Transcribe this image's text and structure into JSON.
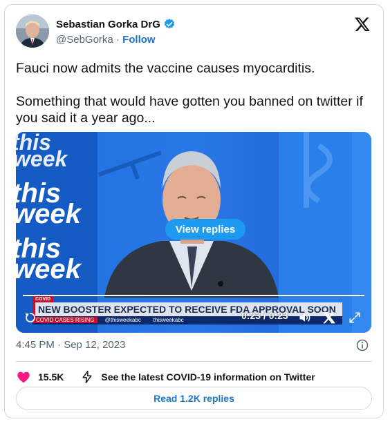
{
  "author": {
    "name": "Sebastian Gorka DrG",
    "handle": "@SebGorka",
    "separator": "·",
    "follow_label": "Follow"
  },
  "tweet": {
    "text": "Fauci now admits the vaccine causes myocarditis.\n\nSomething that would have gotten you banned on twitter if you said it a year ago..."
  },
  "video": {
    "view_replies_label": "View replies",
    "lower_third_tag": "COVID",
    "lower_third_headline": "NEW BOOSTER EXPECTED TO RECEIVE FDA APPROVAL SOON",
    "ticker_label": "COVID CASES RISING",
    "ticker_handle_1": "@thisweekabc",
    "ticker_handle_2": "thisweekabc",
    "time_readout": "0:23 / 0:23",
    "progress": 1.0,
    "show_watermark": "this week"
  },
  "meta": {
    "timestamp": "4:45 PM · Sep 12, 2023"
  },
  "actions": {
    "like_count": "15.5K",
    "covid_info_label": "See the latest COVID-19 information on Twitter",
    "read_replies_label": "Read 1.2K replies"
  },
  "colors": {
    "like_heart": "#f91880",
    "link_blue": "#1d74c9",
    "verified_blue": "#1d9bf0",
    "video_bg": "#1a63d6"
  }
}
